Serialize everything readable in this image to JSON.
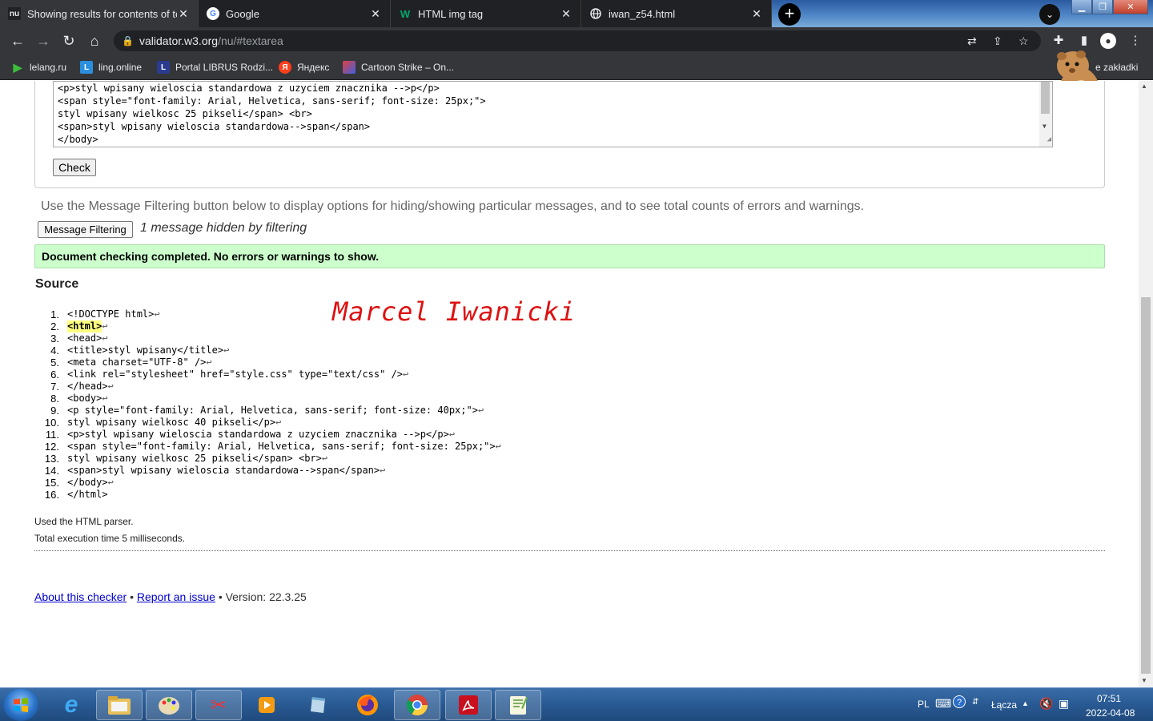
{
  "tabs": [
    {
      "title": "Showing results for contents of te",
      "icon": "nu"
    },
    {
      "title": "Google",
      "icon": "G"
    },
    {
      "title": "HTML img tag",
      "icon": "W"
    },
    {
      "title": "iwan_z54.html",
      "icon": "globe"
    }
  ],
  "address": {
    "host": "validator.w3.org",
    "path": "/nu/#textarea"
  },
  "bookmarks": [
    {
      "label": "lelang.ru"
    },
    {
      "label": "ling.online"
    },
    {
      "label": "Portal LIBRUS Rodzi..."
    },
    {
      "label": "Яндекс"
    },
    {
      "label": "Cartoon Strike – On..."
    },
    {
      "label": "e zakładki"
    }
  ],
  "textarea_lines": [
    "<p>styl wpisany wieloscia standardowa z uzyciem znacznika -->p</p>",
    "<span style=\"font-family: Arial, Helvetica, sans-serif; font-size: 25px;\">",
    "styl wpisany wielkosc 25 pikseli</span> <br>",
    "<span>styl wpisany wieloscia standardowa-->span</span>",
    "</body>"
  ],
  "check_label": "Check",
  "filter": {
    "info": "Use the Message Filtering button below to display options for hiding/showing particular messages, and to see total counts of errors and warnings.",
    "button": "Message Filtering",
    "hidden_note": "1 message hidden by filtering"
  },
  "success_message": "Document checking completed. No errors or warnings to show.",
  "source_heading": "Source",
  "source_lines": [
    {
      "num": "1.",
      "code": "<!DOCTYPE html>"
    },
    {
      "num": "2.",
      "code": "<html>"
    },
    {
      "num": "3.",
      "code": "<head>"
    },
    {
      "num": "4.",
      "code": "<title>styl wpisany</title>"
    },
    {
      "num": "5.",
      "code": "<meta charset=\"UTF-8\" />"
    },
    {
      "num": "6.",
      "code": "<link rel=\"stylesheet\" href=\"style.css\" type=\"text/css\" />"
    },
    {
      "num": "7.",
      "code": "</head>"
    },
    {
      "num": "8.",
      "code": "<body>"
    },
    {
      "num": "9.",
      "code": "<p style=\"font-family: Arial, Helvetica, sans-serif; font-size: 40px;\">"
    },
    {
      "num": "10.",
      "code": "styl wpisany wielkosc 40 pikseli</p>"
    },
    {
      "num": "11.",
      "code": "<p>styl wpisany wieloscia standardowa z uzyciem znacznika -->p</p>"
    },
    {
      "num": "12.",
      "code": "<span style=\"font-family: Arial, Helvetica, sans-serif; font-size: 25px;\">"
    },
    {
      "num": "13.",
      "code": "styl wpisany wielkosc 25 pikseli</span> <br>"
    },
    {
      "num": "14.",
      "code": "<span>styl wpisany wieloscia standardowa-->span</span>"
    },
    {
      "num": "15.",
      "code": "</body>"
    },
    {
      "num": "16.",
      "code": "</html>"
    }
  ],
  "return_mark": "↩",
  "author_overlay": "Marcel Iwanicki",
  "parser_note": "Used the HTML parser.",
  "exec_time": "Total execution time 5 milliseconds.",
  "footer": {
    "about": "About this checker",
    "sep": "•",
    "report": "Report an issue",
    "version": "Version: 22.3.25"
  },
  "taskbar": {
    "lang": "PL",
    "network": "Łącza",
    "time": "07:51",
    "date": "2022-04-08"
  },
  "colors": {
    "success_bg": "#ccffcc",
    "author_red": "#dd1111",
    "link_blue": "#0000cc",
    "chrome_dark": "#35363a"
  }
}
